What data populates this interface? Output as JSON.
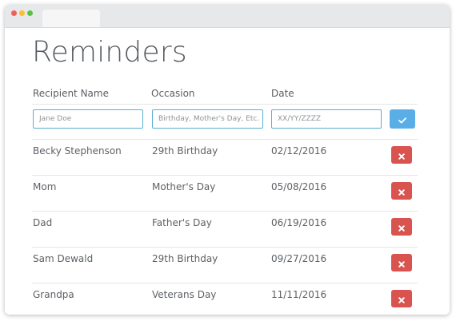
{
  "app": {
    "title": "Reminders"
  },
  "form": {
    "columns": {
      "recipient": "Recipient Name",
      "occasion": "Occasion",
      "date": "Date"
    },
    "placeholders": {
      "recipient": "Jane Doe",
      "occasion": "Birthday, Mother's Day, Etc.",
      "date": "XX/YY/ZZZZ"
    },
    "submit_icon": "check-icon"
  },
  "reminders": [
    {
      "recipient": "Becky Stephenson",
      "occasion": "29th Birthday",
      "date": "02/12/2016"
    },
    {
      "recipient": "Mom",
      "occasion": "Mother's Day",
      "date": "05/08/2016"
    },
    {
      "recipient": "Dad",
      "occasion": "Father's Day",
      "date": "06/19/2016"
    },
    {
      "recipient": "Sam Dewald",
      "occasion": "29th Birthday",
      "date": "09/27/2016"
    },
    {
      "recipient": "Grandpa",
      "occasion": "Veterans Day",
      "date": "11/11/2016"
    }
  ],
  "row_action_icon": "delete-x-icon",
  "colors": {
    "accent": "#5aaee8",
    "input_border": "#5aaed2",
    "delete": "#d9534f",
    "text": "#5d6166"
  }
}
